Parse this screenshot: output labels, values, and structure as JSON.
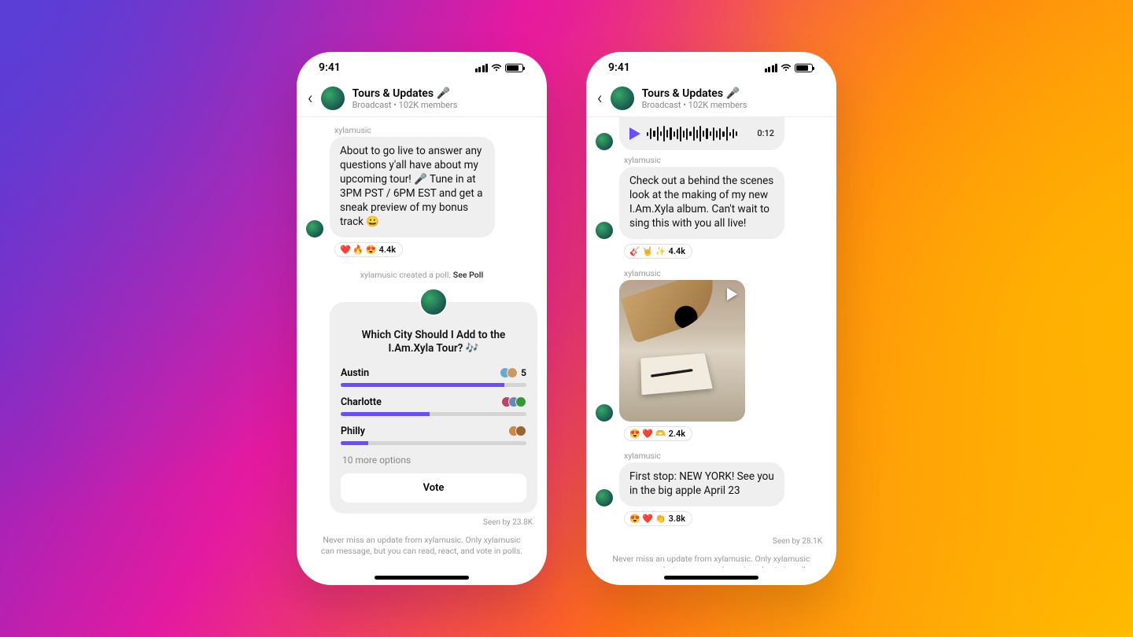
{
  "status": {
    "time": "9:41"
  },
  "header": {
    "title": "Tours & Updates 🎤",
    "sub": "Broadcast • 102K members"
  },
  "username": "xylamusic",
  "footer": "Never miss an update from xylamusic. Only xylamusic can message, but you can read, react, and vote in polls.",
  "left": {
    "msg1": "About to go live to answer any questions y'all have about my upcoming tour! 🎤 Tune in at 3PM PST / 6PM EST and get a sneak preview of my bonus track 😀",
    "react1": {
      "emojis": "❤️ 🔥 😍",
      "count": "4.4k"
    },
    "pollNotice": {
      "prefix": "xylamusic created a poll. ",
      "link": "See Poll"
    },
    "poll": {
      "question": "Which City Should I Add to the I.Am.Xyla Tour? 🎶",
      "opts": [
        {
          "name": "Austin",
          "pct": 88,
          "votes": "5"
        },
        {
          "name": "Charlotte",
          "pct": 48,
          "votes": ""
        },
        {
          "name": "Philly",
          "pct": 15,
          "votes": ""
        }
      ],
      "more": "10 more options",
      "voteLabel": "Vote"
    },
    "seen": "Seen by 23.8K"
  },
  "right": {
    "audio": {
      "duration": "0:12"
    },
    "msg2": "Check out a behind the scenes look at the making of my new I.Am.Xyla album. Can't wait to sing this with you all live!",
    "react2": {
      "emojis": "🎸 🤘 ✨",
      "count": "4.4k"
    },
    "react3": {
      "emojis": "😍 ❤️ 🫶",
      "count": "2.4k"
    },
    "msg4": "First stop: NEW YORK! See you in the big apple April 23",
    "react4": {
      "emojis": "😍 ❤️ 👏",
      "count": "3.8k"
    },
    "seen": "Seen by 28.1K"
  }
}
